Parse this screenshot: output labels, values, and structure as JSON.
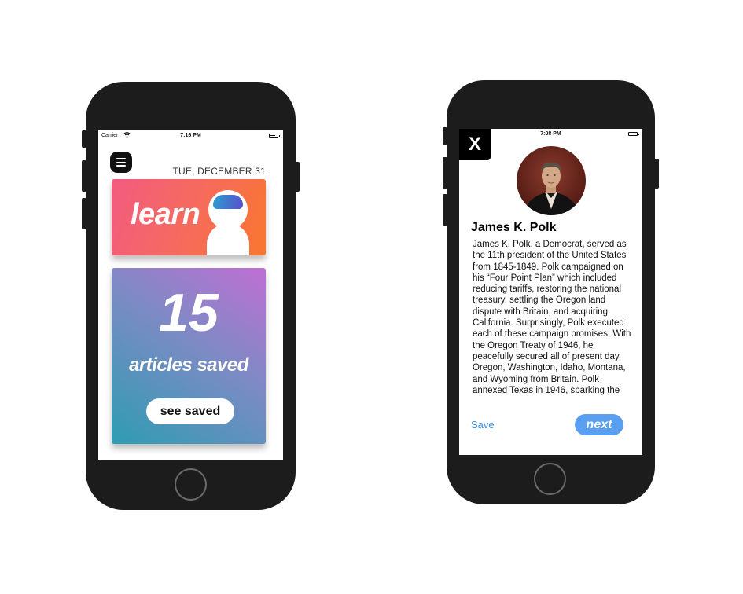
{
  "left_phone": {
    "status": {
      "carrier": "Carrier",
      "time": "7:16 PM"
    },
    "menu_icon": "hamburger-menu-icon",
    "date": "TUE, DECEMBER 31",
    "learn_card": {
      "label": "learn",
      "icon": "mascot-icon"
    },
    "saved_card": {
      "count": "15",
      "label": "articles saved",
      "button": "see saved"
    }
  },
  "right_phone": {
    "status": {
      "time": "7:08 PM"
    },
    "close_label": "X",
    "title": "James K. Polk",
    "body": "James K. Polk, a Democrat, served as the 11th president of the United States from 1845-1849. Polk campaigned on his “Four Point Plan” which included reducing tariffs, restoring the national treasury, settling the Oregon land dispute with Britain, and acquiring California. Surprisingly, Polk executed each of these campaign promises. With the Oregon Treaty of 1946, he peacefully secured all of present day Oregon, Washington, Idaho, Montana, and Wyoming from Britain. Polk annexed Texas in 1946, sparking the",
    "save_label": "Save",
    "next_label": "next"
  },
  "colors": {
    "learn_gradient": [
      "#f25c80",
      "#f8772f"
    ],
    "saved_gradient": [
      "#2e9cb2",
      "#c06fd4"
    ],
    "accent_blue": "#5ba0f0",
    "phone_body": "#1c1c1c"
  }
}
